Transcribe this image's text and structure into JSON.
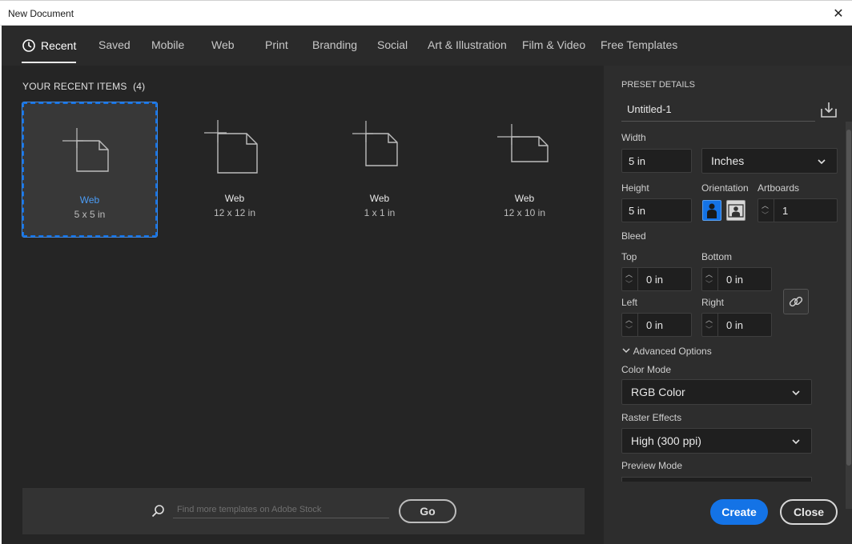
{
  "window": {
    "title": "New Document",
    "close_glyph": "✕"
  },
  "tabs": [
    {
      "label": "Recent",
      "icon": "clock-icon"
    },
    {
      "label": "Saved"
    },
    {
      "label": "Mobile"
    },
    {
      "label": "Web"
    },
    {
      "label": "Print"
    },
    {
      "label": "Branding"
    },
    {
      "label": "Social"
    },
    {
      "label": "Art & Illustration"
    },
    {
      "label": "Film & Video"
    },
    {
      "label": "Free Templates"
    }
  ],
  "recent": {
    "heading": "YOUR RECENT ITEMS",
    "count": "(4)",
    "items": [
      {
        "name": "Web",
        "size": "5 x 5 in"
      },
      {
        "name": "Web",
        "size": "12 x 12 in"
      },
      {
        "name": "Web",
        "size": "1 x 1 in"
      },
      {
        "name": "Web",
        "size": "12 x 10 in"
      }
    ]
  },
  "search": {
    "placeholder": "Find more templates on Adobe Stock",
    "go_label": "Go"
  },
  "preset": {
    "heading": "PRESET DETAILS",
    "name": "Untitled-1",
    "width_label": "Width",
    "width_value": "5 in",
    "units": "Inches",
    "height_label": "Height",
    "height_value": "5 in",
    "orientation_label": "Orientation",
    "artboards_label": "Artboards",
    "artboards_value": "1",
    "bleed_label": "Bleed",
    "top_label": "Top",
    "top_value": "0 in",
    "bottom_label": "Bottom",
    "bottom_value": "0 in",
    "left_label": "Left",
    "left_value": "0 in",
    "right_label": "Right",
    "right_value": "0 in",
    "advanced_label": "Advanced Options",
    "color_mode_label": "Color Mode",
    "color_mode_value": "RGB Color",
    "raster_label": "Raster Effects",
    "raster_value": "High (300 ppi)",
    "preview_label": "Preview Mode"
  },
  "actions": {
    "create": "Create",
    "close": "Close"
  },
  "colors": {
    "accent": "#1473e6",
    "background": "#252525",
    "panel": "#2d2d2d"
  }
}
